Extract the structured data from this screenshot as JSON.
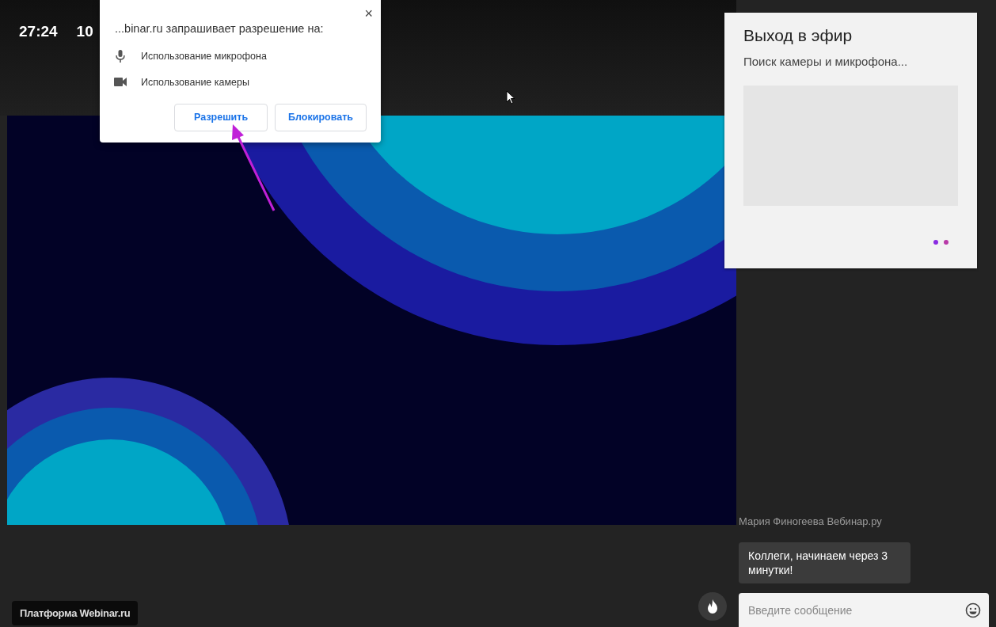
{
  "header": {
    "timer": "27:24",
    "counter": "10"
  },
  "permission_popup": {
    "close": "×",
    "message": "...binar.ru запрашивает разрешение на:",
    "permissions": [
      {
        "kind": "microphone",
        "label": "Использование микрофона"
      },
      {
        "kind": "camera",
        "label": "Использование камеры"
      }
    ],
    "buttons": [
      "Разрешить",
      "Блокировать"
    ]
  },
  "golive_panel": {
    "title": "Выход в эфир",
    "status": "Поиск камеры и микрофона..."
  },
  "chat": {
    "messages": [
      {
        "author": "Мария Финогеева Вебинар.ру",
        "text": "Коллеги, начинаем через 3 минутки!"
      }
    ],
    "input": {
      "placeholder": "Введите сообщение"
    }
  },
  "footer_badge": "Платформа Webinar.ru"
}
